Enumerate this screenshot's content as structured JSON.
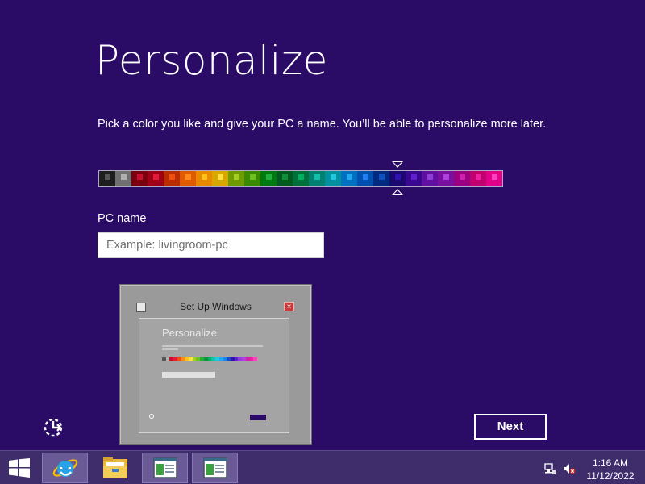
{
  "page": {
    "title": "Personalize",
    "description": "Pick a color you like and give your PC a name. You’ll be able to personalize more later."
  },
  "palette": {
    "selected_index": 18,
    "colors": [
      {
        "bg": "#1e1e1e",
        "chip": "#555555"
      },
      {
        "bg": "#707070",
        "chip": "#b0b0b0"
      },
      {
        "bg": "#7a0010",
        "chip": "#c8102e"
      },
      {
        "bg": "#a00018",
        "chip": "#e61a3a"
      },
      {
        "bg": "#b82c00",
        "chip": "#f05010"
      },
      {
        "bg": "#e05a00",
        "chip": "#ff8a1a"
      },
      {
        "bg": "#e88a00",
        "chip": "#ffc01a"
      },
      {
        "bg": "#d8a800",
        "chip": "#ffe040"
      },
      {
        "bg": "#6e9c00",
        "chip": "#a6d020"
      },
      {
        "bg": "#3a8a00",
        "chip": "#70c020"
      },
      {
        "bg": "#007a10",
        "chip": "#20b040"
      },
      {
        "bg": "#005a20",
        "chip": "#10903a"
      },
      {
        "bg": "#00703a",
        "chip": "#00b060"
      },
      {
        "bg": "#008070",
        "chip": "#10c0a8"
      },
      {
        "bg": "#0090a0",
        "chip": "#20c8e0"
      },
      {
        "bg": "#0070c0",
        "chip": "#20a8f0"
      },
      {
        "bg": "#0050b0",
        "chip": "#2080f0"
      },
      {
        "bg": "#002a80",
        "chip": "#1050c0"
      },
      {
        "bg": "#1a0870",
        "chip": "#3010b0"
      },
      {
        "bg": "#3a0890",
        "chip": "#6020d0"
      },
      {
        "bg": "#6010a0",
        "chip": "#9040d8"
      },
      {
        "bg": "#7a10a0",
        "chip": "#b040e0"
      },
      {
        "bg": "#9a0080",
        "chip": "#d020b0"
      },
      {
        "bg": "#c00070",
        "chip": "#f020a0"
      },
      {
        "bg": "#e0008a",
        "chip": "#ff40c0"
      }
    ]
  },
  "pc_name": {
    "label": "PC name",
    "value": "",
    "placeholder": "Example: livingroom-pc"
  },
  "buttons": {
    "next_label": "Next"
  },
  "preview": {
    "window_title": "Set Up Windows",
    "close_glyph": "×",
    "heading": "Personalize"
  },
  "taskbar": {
    "clock_time": "1:16 AM",
    "clock_date": "11/12/2022"
  },
  "colors": {
    "background": "#2a0c66",
    "taskbar": "#3e2d6a"
  }
}
